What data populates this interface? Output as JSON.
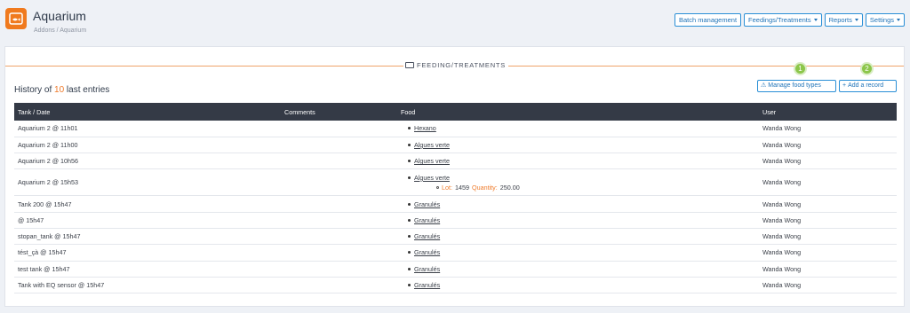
{
  "app": {
    "title": "Aquarium",
    "breadcrumb": "Addons / Aquarium"
  },
  "top_actions": {
    "batch": "Batch management",
    "feedings": "Feedings/Treatments",
    "reports": "Reports",
    "settings": "Settings"
  },
  "panel": {
    "title": "FEEDING/TREATMENTS",
    "history_prefix": "History of",
    "history_count": "10",
    "history_suffix": "last entries",
    "badges": [
      "1",
      "2"
    ],
    "manage_label": "Manage food types",
    "add_label": "Add a record"
  },
  "table": {
    "headers": [
      "Tank / Date",
      "Comments",
      "Food",
      "User"
    ],
    "rows": [
      {
        "tank": "Aquarium 2 @ 11h01",
        "comments": "",
        "food": "Hexano",
        "user": "Wanda Wong"
      },
      {
        "tank": "Aquarium 2 @ 11h00",
        "comments": "",
        "food": "Algues verte",
        "user": "Wanda Wong"
      },
      {
        "tank": "Aquarium 2 @ 10h56",
        "comments": "",
        "food": "Algues verte",
        "user": "Wanda Wong"
      },
      {
        "tank": "Aquarium 2 @ 15h53",
        "comments": "",
        "food": "Algues verte",
        "user": "Wanda Wong",
        "lot_label": "Lot:",
        "lot": "1459",
        "qty_label": "Quantity:",
        "qty": "250.00"
      },
      {
        "tank": "Tank 200 @ 15h47",
        "comments": "",
        "food": "Granulés",
        "user": "Wanda Wong"
      },
      {
        "tank": "@ 15h47",
        "comments": "",
        "food": "Granulés",
        "user": "Wanda Wong"
      },
      {
        "tank": "stopan_tank @ 15h47",
        "comments": "",
        "food": "Granulés",
        "user": "Wanda Wong"
      },
      {
        "tank": "tést_çà @ 15h47",
        "comments": "",
        "food": "Granulés",
        "user": "Wanda Wong"
      },
      {
        "tank": "test tank @ 15h47",
        "comments": "",
        "food": "Granulés",
        "user": "Wanda Wong"
      },
      {
        "tank": "Tank with EQ sensor @ 15h47",
        "comments": "",
        "food": "Granulés",
        "user": "Wanda Wong"
      }
    ]
  },
  "colors": {
    "accent": "#f07a1e",
    "link_blue": "#1f73b8",
    "header_dark": "#343a46",
    "badge_green": "#8cc64a"
  }
}
